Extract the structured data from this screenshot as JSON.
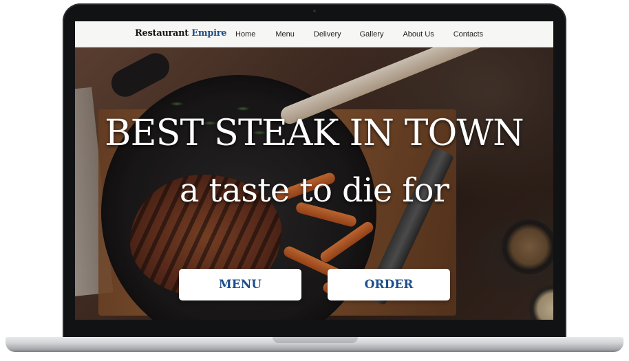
{
  "navbar": {
    "brand_part1": "Restaurant",
    "brand_part2": "Empire",
    "links": [
      "Home",
      "Menu",
      "Delivery",
      "Gallery",
      "About Us",
      "Contacts"
    ]
  },
  "hero": {
    "headline": "BEST STEAK IN TOWN",
    "subline": "a taste to die for",
    "buttons": {
      "menu": "MENU",
      "order": "ORDER"
    }
  },
  "colors": {
    "brand_accent": "#1d4e8c",
    "nav_bg": "#f6f6f4",
    "button_bg": "#ffffff",
    "laptop_bezel": "#111214"
  }
}
